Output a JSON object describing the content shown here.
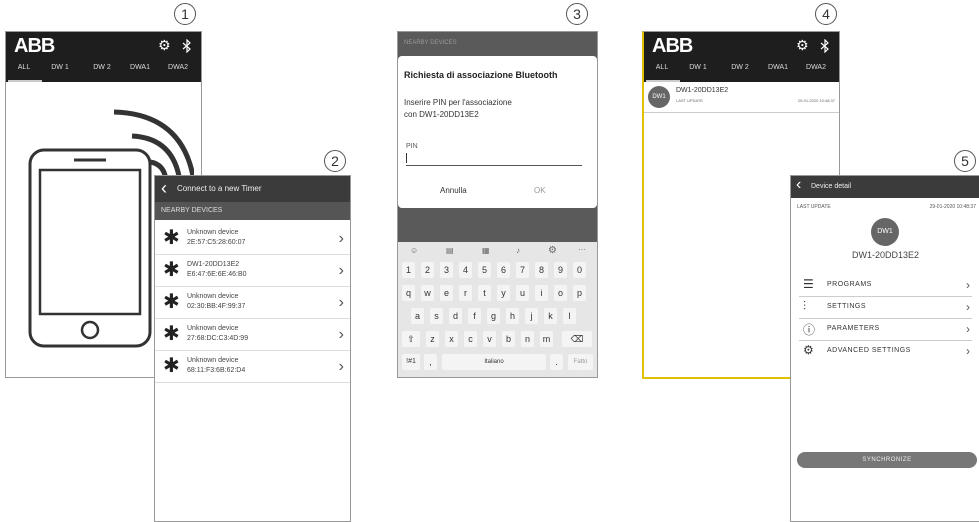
{
  "steps": [
    "1",
    "2",
    "3",
    "4",
    "5"
  ],
  "screen1": {
    "logo": "ABB",
    "icons": [
      "gear-icon",
      "bluetooth-icon"
    ],
    "tabs": [
      "ALL",
      "DW 1",
      "DW 2",
      "DWA1",
      "DWA2"
    ]
  },
  "screen2": {
    "header": "Connect to a new Timer",
    "section": "NEARBY DEVICES",
    "devices": [
      {
        "name": "Unknown device",
        "mac": "2E:57:C5:28:60:07"
      },
      {
        "name": "DW1-20DD13E2",
        "mac": "E6:47:6E:6E:46:B0"
      },
      {
        "name": "Unknown device",
        "mac": "02:30:BB:4F:99:37"
      },
      {
        "name": "Unknown device",
        "mac": "27:68:DC:C3:4D:99"
      },
      {
        "name": "Unknown device",
        "mac": "68:11:F3:6B:62:D4"
      }
    ]
  },
  "screen3": {
    "bg_label": "NEARBY DEVICES",
    "dialog_title": "Richiesta di associazione Bluetooth",
    "dialog_text_1": "Inserire PIN per l'associazione",
    "dialog_text_2": "con DW1-20DD13E2",
    "pin_label": "PIN",
    "cancel": "Annulla",
    "ok": "OK",
    "keys_row1": [
      "1",
      "2",
      "3",
      "4",
      "5",
      "6",
      "7",
      "8",
      "9",
      "0"
    ],
    "keys_row2": [
      "q",
      "w",
      "e",
      "r",
      "t",
      "y",
      "u",
      "i",
      "o",
      "p"
    ],
    "keys_row3": [
      "a",
      "s",
      "d",
      "f",
      "g",
      "h",
      "j",
      "k",
      "l"
    ],
    "keys_row4": [
      "z",
      "x",
      "c",
      "v",
      "b",
      "n",
      "m"
    ],
    "key_sym": "!#1",
    "key_comma": ",",
    "key_space": "Italiano",
    "key_dot": ".",
    "key_done": "Fatto"
  },
  "screen4": {
    "logo": "ABB",
    "tabs": [
      "ALL",
      "DW 1",
      "DW 2",
      "DWA1",
      "DWA2"
    ],
    "device_avatar": "DW1",
    "device_name": "DW1-20DD13E2",
    "last_update_label": "LAST UPDATE",
    "last_update_value": "29-01-2020 10:48:37"
  },
  "screen5": {
    "header": "Device detail",
    "last_update_label": "LAST UPDATE",
    "last_update_value": "29-01-2020 10:48:37",
    "avatar": "DW1",
    "device_name": "DW1-20DD13E2",
    "menu": [
      {
        "label": "PROGRAMS",
        "icon": "list-icon"
      },
      {
        "label": "SETTINGS",
        "icon": "sliders-icon"
      },
      {
        "label": "PARAMETERS",
        "icon": "info-icon"
      },
      {
        "label": "ADVANCED SETTINGS",
        "icon": "gears-icon"
      }
    ],
    "sync_button": "SYNCHRONIZE"
  }
}
